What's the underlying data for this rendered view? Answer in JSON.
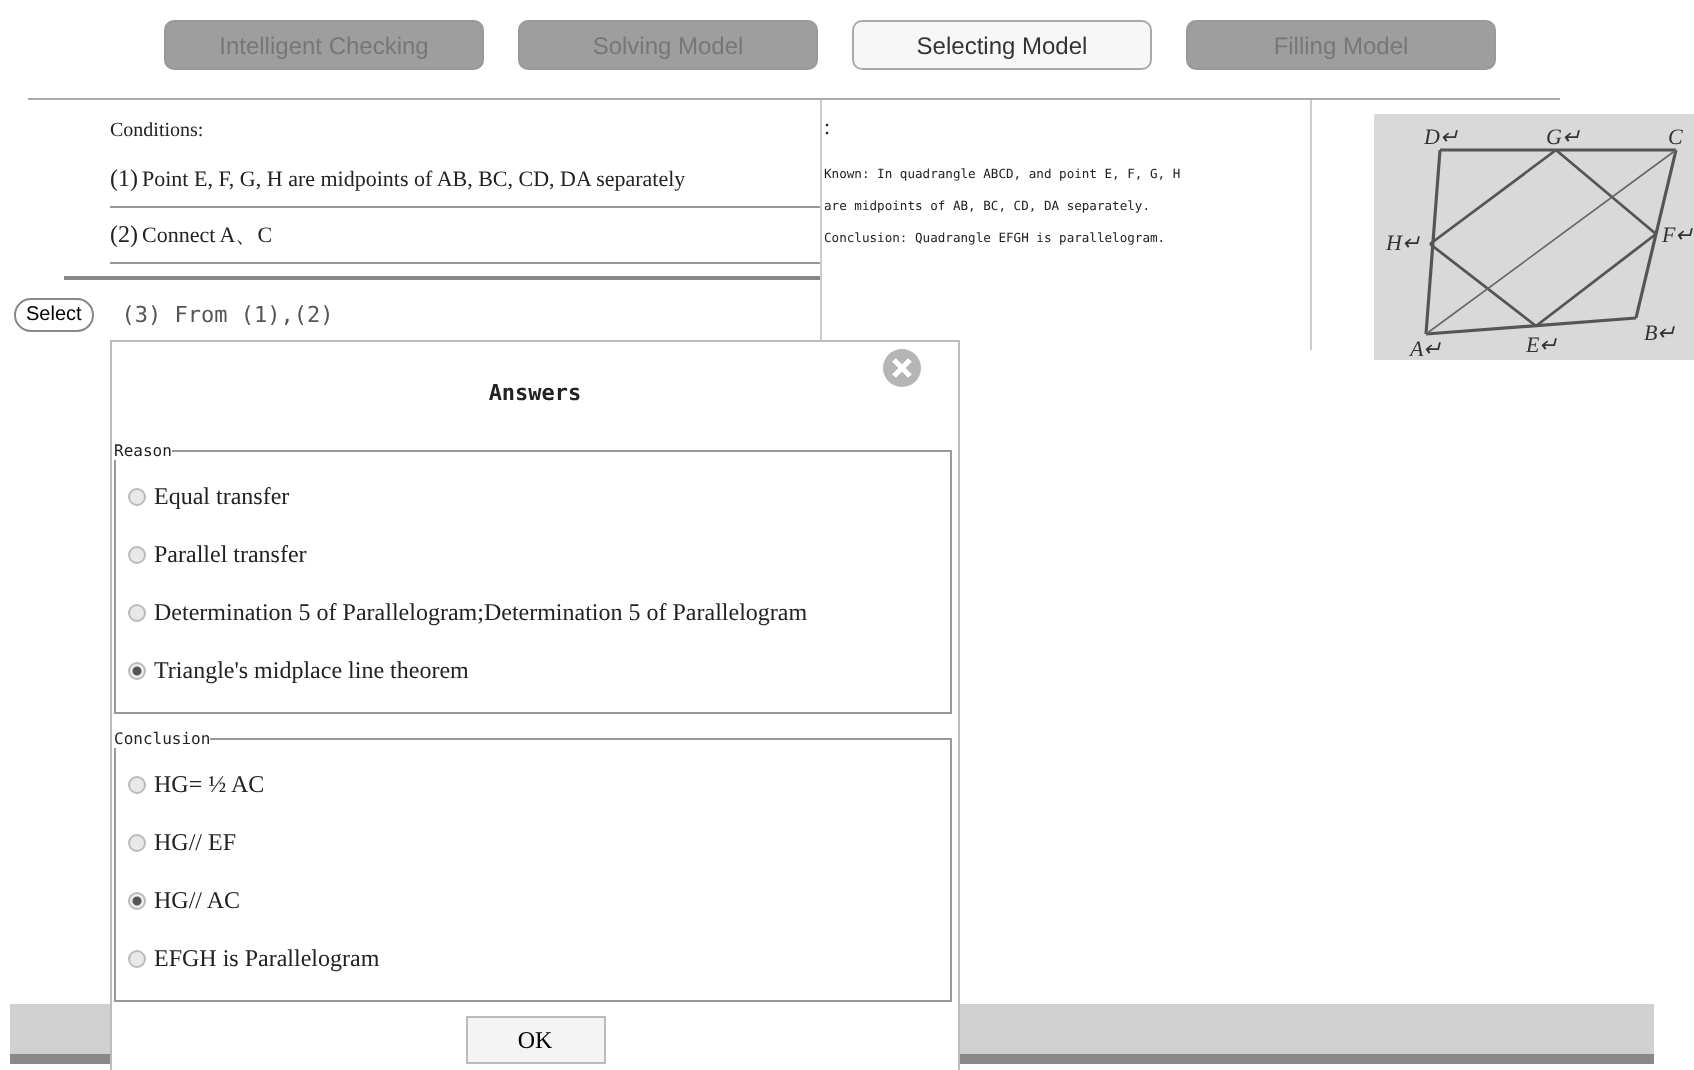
{
  "tabs": [
    {
      "label": "Intelligent Checking",
      "selected": false
    },
    {
      "label": "Solving Model",
      "selected": false
    },
    {
      "label": "Selecting Model",
      "selected": true
    },
    {
      "label": "Filling Model",
      "selected": false
    }
  ],
  "conditions": {
    "title": "Conditions:",
    "items": [
      {
        "number": "(1)",
        "text": "Point E, F, G, H are midpoints of AB, BC, CD, DA separately"
      },
      {
        "number": "(2)",
        "text": "Connect A、C"
      }
    ]
  },
  "select_button": "Select",
  "step": "(3) From (1),(2)",
  "known": {
    "mark": ":",
    "lines": [
      "Known: In quadrangle ABCD, and point E, F, G, H",
      "are midpoints of AB, BC, CD, DA separately.",
      "Conclusion: Quadrangle EFGH is parallelogram."
    ]
  },
  "figure": {
    "labels": [
      "D↵",
      "G↵",
      "C",
      "H↵",
      "F↵",
      "A↵",
      "E↵",
      "B↵"
    ]
  },
  "dialog": {
    "title": "Answers",
    "groups": [
      {
        "legend": "Reason",
        "options": [
          {
            "label": "Equal transfer",
            "selected": false
          },
          {
            "label": "Parallel transfer",
            "selected": false
          },
          {
            "label": "Determination 5 of Parallelogram;Determination 5 of Parallelogram",
            "selected": false
          },
          {
            "label": "Triangle's midplace line theorem",
            "selected": true
          }
        ]
      },
      {
        "legend": "Conclusion",
        "options": [
          {
            "label": "HG= ½ AC",
            "selected": false
          },
          {
            "label": "HG// EF",
            "selected": false
          },
          {
            "label": "HG// AC",
            "selected": true
          },
          {
            "label": "EFGH is Parallelogram",
            "selected": false
          }
        ]
      }
    ],
    "ok_button": "OK"
  }
}
